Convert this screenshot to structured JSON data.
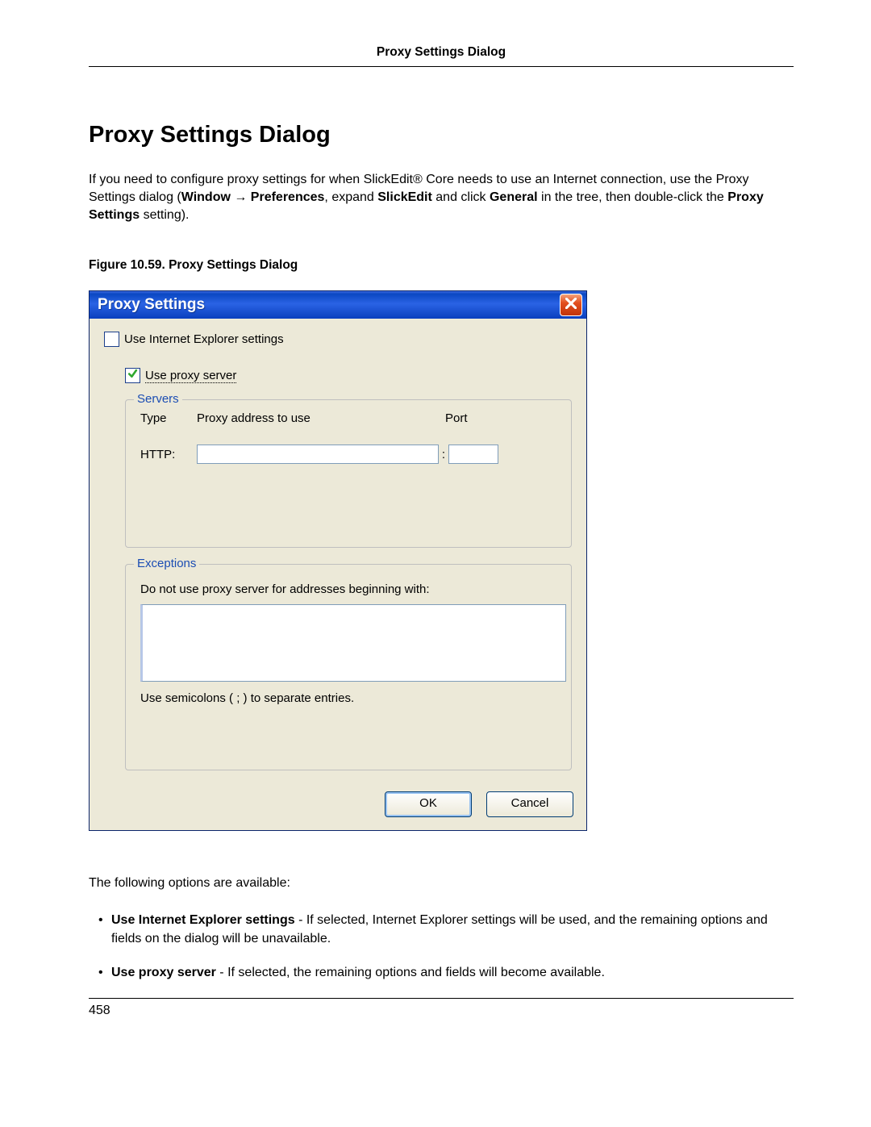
{
  "header": {
    "title": "Proxy Settings Dialog"
  },
  "section": {
    "heading": "Proxy Settings Dialog",
    "intro_pre": "If you need to configure proxy settings for when SlickEdit",
    "intro_reg": "®",
    "intro_post1": " Core needs to use an Internet connection, use the Proxy Settings dialog (",
    "b_window": "Window",
    "arrow": " → ",
    "b_prefs": "Preferences",
    "intro_post2": ", expand ",
    "b_slick": "SlickEdit",
    "intro_post3": " and click ",
    "b_general": "General",
    "intro_post4": " in the tree, then double-click the ",
    "b_proxyset": "Proxy Settings",
    "intro_post5": " setting).",
    "figcap": "Figure 10.59. Proxy Settings Dialog"
  },
  "dialog": {
    "title": "Proxy Settings",
    "use_ie": "Use Internet Explorer settings",
    "use_proxy": "Use proxy server",
    "servers_legend": "Servers",
    "col_type": "Type",
    "col_addr": "Proxy address to use",
    "col_port": "Port",
    "row_http": "HTTP:",
    "colon": ":",
    "exceptions_legend": "Exceptions",
    "exceptions_text": "Do not use proxy server for addresses beginning with:",
    "exceptions_hint": "Use semicolons ( ; ) to separate entries.",
    "ok": "OK",
    "cancel": "Cancel"
  },
  "after": {
    "follow": "The following options are available:",
    "opt1_b": "Use Internet Explorer settings",
    "opt1_rest": " - If selected, Internet Explorer settings will be used, and the remaining options and fields on the dialog will be unavailable.",
    "opt2_b": "Use proxy server",
    "opt2_rest": " - If selected, the remaining options and fields will become available."
  },
  "footer": {
    "pagenum": "458"
  }
}
